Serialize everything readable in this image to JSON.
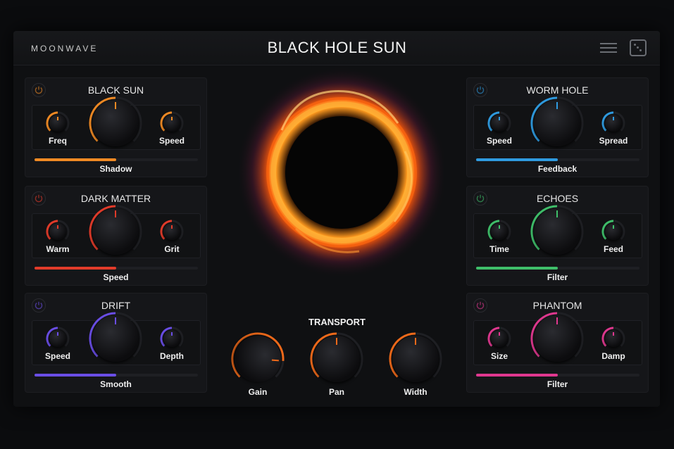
{
  "header": {
    "brand": "MOONWAVE",
    "title": "BLACK HOLE SUN"
  },
  "modules": [
    {
      "id": "black-sun",
      "title": "BLACK SUN",
      "color": "#f08a24",
      "knobs": [
        "Freq",
        "",
        "Speed"
      ],
      "slider_label": "Shadow",
      "slider_value": 0.5
    },
    {
      "id": "dark-matter",
      "title": "DARK MATTER",
      "color": "#e23b2a",
      "knobs": [
        "Warm",
        "",
        "Grit"
      ],
      "slider_label": "Speed",
      "slider_value": 0.5
    },
    {
      "id": "drift",
      "title": "DRIFT",
      "color": "#6a4ee6",
      "knobs": [
        "Speed",
        "",
        "Depth"
      ],
      "slider_label": "Smooth",
      "slider_value": 0.5
    },
    {
      "id": "worm-hole",
      "title": "WORM HOLE",
      "color": "#2f9be0",
      "knobs": [
        "Speed",
        "",
        "Spread"
      ],
      "slider_label": "Feedback",
      "slider_value": 0.5
    },
    {
      "id": "echoes",
      "title": "ECHOES",
      "color": "#3fbf6a",
      "knobs": [
        "Time",
        "",
        "Feed"
      ],
      "slider_label": "Filter",
      "slider_value": 0.5
    },
    {
      "id": "phantom",
      "title": "PHANTOM",
      "color": "#e0388f",
      "knobs": [
        "Size",
        "",
        "Damp"
      ],
      "slider_label": "Filter",
      "slider_value": 0.5
    }
  ],
  "transport": {
    "title": "TRANSPORT",
    "knobs": [
      {
        "label": "Gain",
        "value": 0.85
      },
      {
        "label": "Pan",
        "value": 0.5
      },
      {
        "label": "Width",
        "value": 0.5
      }
    ]
  },
  "colors": {
    "accent_transport": "#f06a1a",
    "background": "#0b0c0e"
  },
  "icons": [
    "power-icon",
    "menu-icon",
    "dice-icon"
  ]
}
